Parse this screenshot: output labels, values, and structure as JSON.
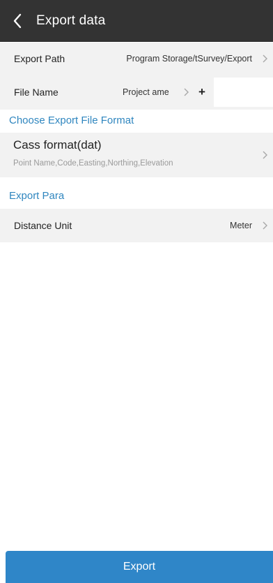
{
  "header": {
    "title": "Export data"
  },
  "export_path": {
    "label": "Export Path",
    "value": "Program Storage/tSurvey/Export"
  },
  "file_name": {
    "label": "File Name",
    "value": "Project ame",
    "add_symbol": "+",
    "input_value": ""
  },
  "format_section": {
    "title": "Choose Export File Format",
    "format_name": "Cass format(dat)",
    "format_fields": "Point Name,Code,Easting,Northing,Elevation"
  },
  "para_section": {
    "title": "Export Para",
    "distance_unit_label": "Distance Unit",
    "distance_unit_value": "Meter"
  },
  "footer": {
    "export_label": "Export"
  },
  "colors": {
    "header_bg": "#333333",
    "accent": "#2f86bf",
    "button_bg": "#2f86c8",
    "row_bg": "#f2f2f2"
  },
  "icons": {
    "back": "chevron-left-icon",
    "chevron": "chevron-right-icon"
  }
}
